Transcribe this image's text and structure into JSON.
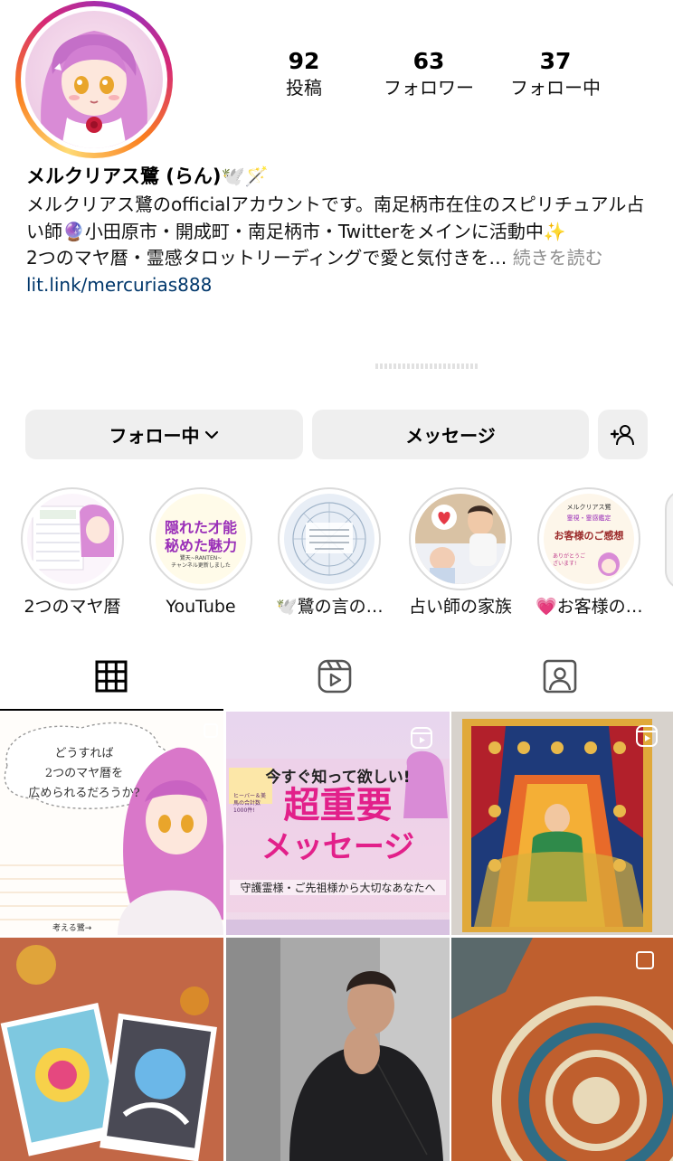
{
  "profile": {
    "name": "メルクリアス鷺 (らん)🕊️🪄",
    "stats": [
      {
        "value": "92",
        "label": "投稿"
      },
      {
        "value": "63",
        "label": "フォロワー"
      },
      {
        "value": "37",
        "label": "フォロー中"
      }
    ],
    "bio_line1": "メルクリアス鷺のofficialアカウントです。南足柄市在住のスピリチュアル占い師🔮小田原市・開成町・南足柄市・Twitterをメインに活動中✨",
    "bio_line2": "2つのマヤ暦・霊感タロットリーディングで愛と気付きを…",
    "more_label": "続きを読む",
    "link": "lit.link/mercurias888"
  },
  "actions": {
    "following_label": "フォロー中",
    "message_label": "メッセージ"
  },
  "highlights": [
    {
      "label": "2つのマヤ暦"
    },
    {
      "label": "YouTube"
    },
    {
      "label": "🕊️鷺の言の…"
    },
    {
      "label": "占い師の家族"
    },
    {
      "label": "💗お客様の…"
    }
  ],
  "highlight_covers": {
    "youtube_line1": "隠れた才能",
    "youtube_line2": "秘めた魅力",
    "youtube_sub": "鷺天~RANTEN~\nチャンネル更新しました",
    "customer_top": "メルクリアス鷺",
    "customer_sub": "霊視・霊感鑑定",
    "customer_title": "お客様のご感想",
    "customer_thanks": "ありがとうございます!"
  },
  "posts": {
    "p1_title1": "どうすれば",
    "p1_title2": "2つのマヤ暦を",
    "p1_title3": "広められるだろうか?",
    "p1_caption": "考える鷺→",
    "p2_top": "今すぐ知って欲しい!",
    "p2_big1": "超重要",
    "p2_big2": "メッセージ",
    "p2_bottom": "守護霊様・ご先祖様から大切なあなたへ",
    "p2_badge": "ヒーバー＆美馬の合計数1000件!"
  },
  "colors": {
    "link": "#00376b",
    "button_bg": "#efefef",
    "muted": "#8e8e8e",
    "p2_magenta": "#e2208a"
  }
}
